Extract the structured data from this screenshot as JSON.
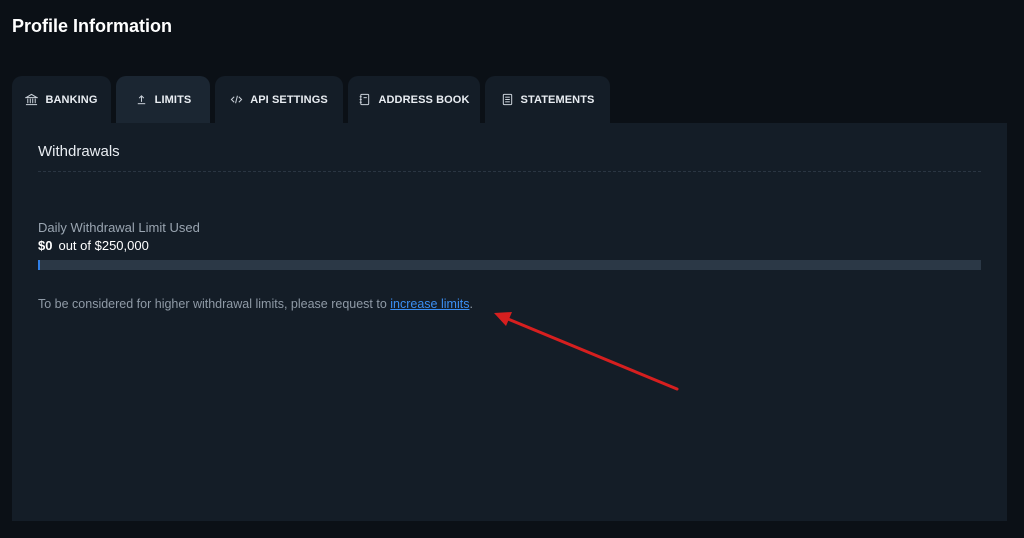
{
  "page": {
    "title": "Profile Information"
  },
  "tabs": [
    {
      "label": "BANKING",
      "icon": "bank-icon",
      "active": false
    },
    {
      "label": "LIMITS",
      "icon": "upload-icon",
      "active": true
    },
    {
      "label": "API SETTINGS",
      "icon": "code-icon",
      "active": false
    },
    {
      "label": "ADDRESS BOOK",
      "icon": "address-book-icon",
      "active": false
    },
    {
      "label": "STATEMENTS",
      "icon": "document-icon",
      "active": false
    }
  ],
  "withdrawals": {
    "title": "Withdrawals",
    "limit_label": "Daily Withdrawal Limit Used",
    "used": "$0",
    "out_of": "out of $250,000",
    "progress_fraction": 0.0,
    "note_prefix": "To be considered for higher withdrawal limits, please request to ",
    "note_link": "increase limits",
    "note_suffix": "."
  },
  "annotation": {
    "arrow_color": "#d61f1f"
  },
  "colors": {
    "background": "#0b1016",
    "panel": "#141d27",
    "accent": "#2f7fe8",
    "link": "#3a8ef2"
  }
}
